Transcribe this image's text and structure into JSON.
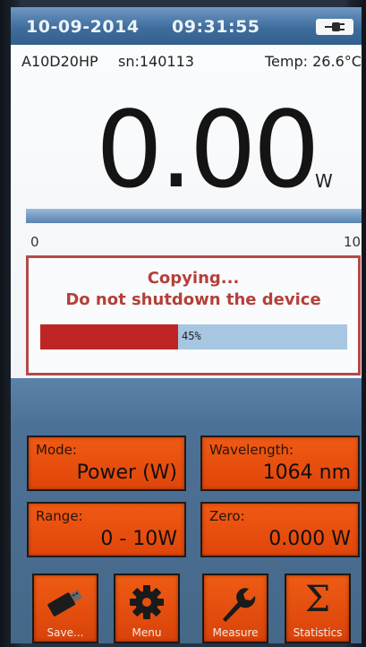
{
  "status_bar": {
    "date": "10-09-2014",
    "time": "09:31:55",
    "power_icon": "plug-icon"
  },
  "device_info": {
    "model": "A10D20HP",
    "serial": "sn:140113",
    "temperature": "Temp: 26.6°C"
  },
  "measurement": {
    "value": "0.00",
    "unit": "W",
    "scale_min": "0",
    "scale_max": "10"
  },
  "dialog": {
    "line1": "Copying...",
    "line2": "Do not shutdown the device",
    "progress_percent": 45,
    "progress_label": "45%"
  },
  "parameters": {
    "mode": {
      "label": "Mode:",
      "value": "Power (W)"
    },
    "wavelength": {
      "label": "Wavelength:",
      "value": "1064 nm"
    },
    "range": {
      "label": "Range:",
      "value": "0 - 10W"
    },
    "zero": {
      "label": "Zero:",
      "value": "0.000 W"
    }
  },
  "buttons": {
    "save": {
      "label": "Save...",
      "icon": "usb-drive-icon"
    },
    "menu": {
      "label": "Menu",
      "icon": "gear-icon"
    },
    "measure": {
      "label": "Measure",
      "icon": "wrench-icon"
    },
    "statistics": {
      "label": "Statistics",
      "icon": "sigma-icon"
    }
  },
  "colors": {
    "accent_orange": "#e84e0f",
    "status_blue": "#4a78a6",
    "dialog_red": "#b4403a",
    "progress_red": "#bf2424",
    "progress_bg": "#a7c6e2"
  }
}
